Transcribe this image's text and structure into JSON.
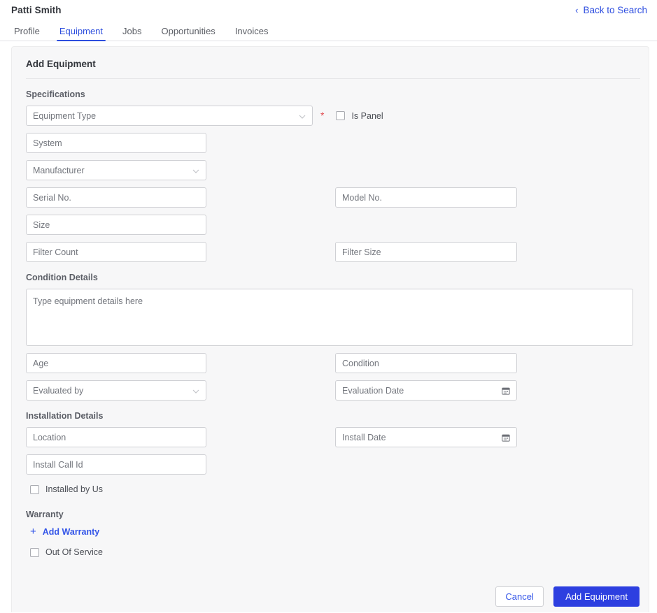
{
  "header": {
    "contact_name": "Patti Smith",
    "back_link": "Back to Search",
    "back_icon": "chevron-left-icon"
  },
  "tabs": [
    {
      "label": "Profile",
      "active": false
    },
    {
      "label": "Equipment",
      "active": true
    },
    {
      "label": "Jobs",
      "active": false
    },
    {
      "label": "Opportunities",
      "active": false
    },
    {
      "label": "Invoices",
      "active": false
    }
  ],
  "panel": {
    "title": "Add Equipment",
    "sections": {
      "specifications": {
        "title": "Specifications",
        "equipment_type": {
          "placeholder": "Equipment Type",
          "required_marker": "*"
        },
        "is_panel": {
          "label": "Is Panel",
          "checked": false
        },
        "system": {
          "placeholder": "System"
        },
        "manufacturer": {
          "placeholder": "Manufacturer"
        },
        "serial_no": {
          "placeholder": "Serial No."
        },
        "model_no": {
          "placeholder": "Model No."
        },
        "size": {
          "placeholder": "Size"
        },
        "filter_count": {
          "placeholder": "Filter Count"
        },
        "filter_size": {
          "placeholder": "Filter Size"
        }
      },
      "condition_details": {
        "title": "Condition Details",
        "details": {
          "placeholder": "Type equipment details here"
        },
        "age": {
          "placeholder": "Age"
        },
        "condition": {
          "placeholder": "Condition"
        },
        "evaluated_by": {
          "placeholder": "Evaluated by"
        },
        "evaluation_date": {
          "placeholder": "Evaluation Date",
          "icon": "calendar-icon"
        }
      },
      "installation_details": {
        "title": "Installation Details",
        "location": {
          "placeholder": "Location"
        },
        "install_date": {
          "placeholder": "Install Date",
          "icon": "calendar-icon"
        },
        "install_call_id": {
          "placeholder": "Install Call Id"
        },
        "installed_by_us": {
          "label": "Installed by Us",
          "checked": false
        }
      },
      "warranty": {
        "title": "Warranty",
        "add_warranty": "Add Warranty",
        "add_icon": "plus-icon",
        "out_of_service": {
          "label": "Out Of Service",
          "checked": false
        }
      }
    }
  },
  "footer": {
    "cancel_label": "Cancel",
    "submit_label": "Add Equipment"
  },
  "colors": {
    "accent_blue": "#2d4ede",
    "primary_button": "#2d3fe0",
    "link_blue": "#3355e8",
    "required_red": "#e0484d",
    "panel_bg": "#f7f7f8",
    "field_border": "#cfd0d4"
  }
}
